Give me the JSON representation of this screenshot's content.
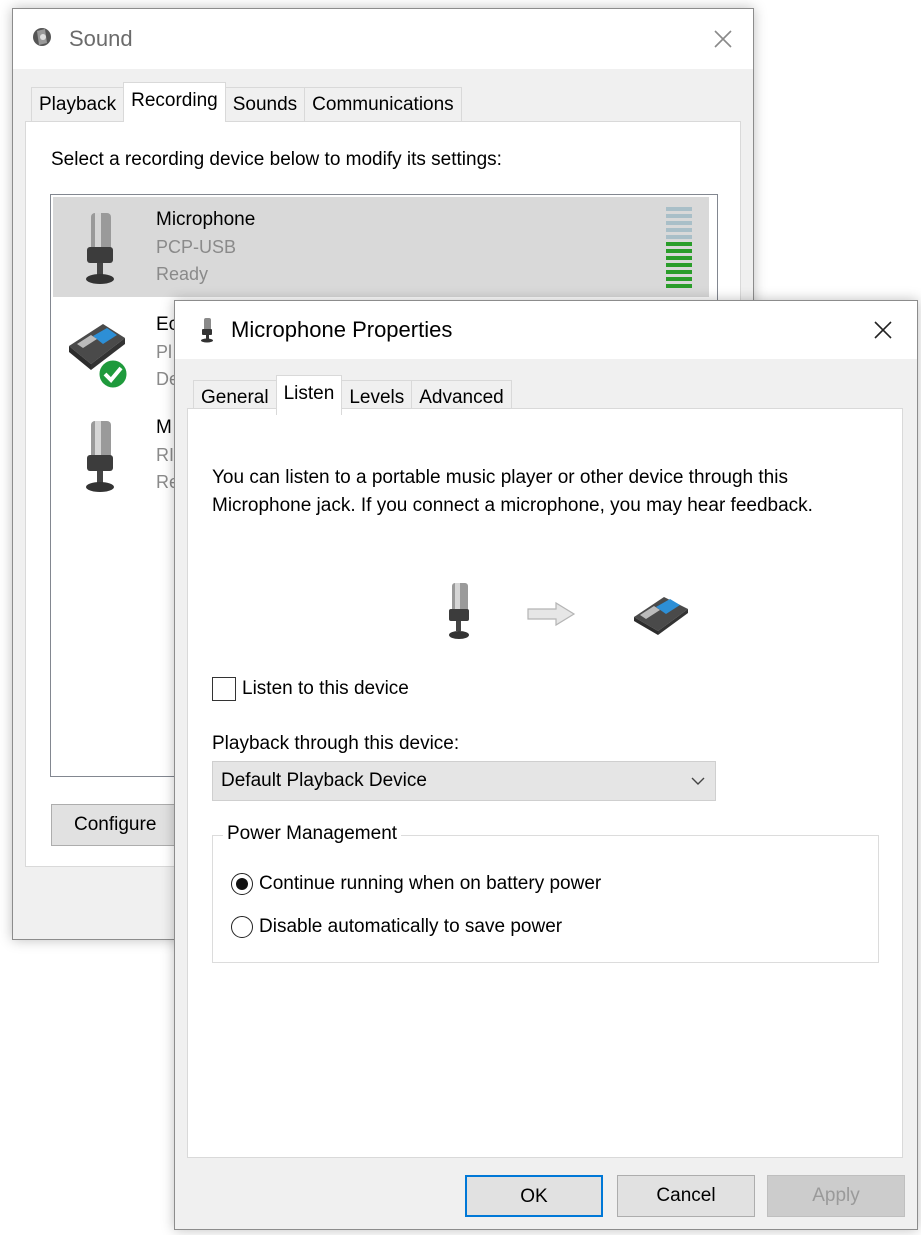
{
  "sound_window": {
    "title": "Sound",
    "tabs": [
      "Playback",
      "Recording",
      "Sounds",
      "Communications"
    ],
    "active_tab": "Recording",
    "instruction": "Select a recording device below to modify its settings:",
    "devices": [
      {
        "name": "Microphone",
        "sub": "PCP-USB",
        "status": "Ready",
        "icon": "microphone-icon",
        "selected": true
      },
      {
        "name": "Ec",
        "sub": "Pl",
        "status": "De",
        "icon": "speakerphone-icon",
        "default_badge": "checkmark-icon"
      },
      {
        "name": "M",
        "sub": "RI",
        "status": "Re",
        "icon": "microphone-icon"
      }
    ],
    "configure_label": "Configure",
    "meter_colors": {
      "active": "#2a9d2a",
      "inactive": "#a9bfc8"
    }
  },
  "props_window": {
    "title": "Microphone Properties",
    "tabs": [
      "General",
      "Listen",
      "Levels",
      "Advanced"
    ],
    "active_tab": "Listen",
    "description": "You can listen to a portable music player or other device through this Microphone jack.  If you connect a microphone, you may hear feedback.",
    "listen_checkbox_label": "Listen to this device",
    "listen_checked": false,
    "playback_label": "Playback through this device:",
    "playback_value": "Default Playback Device",
    "power_group_title": "Power Management",
    "power_options": [
      "Continue running when on battery power",
      "Disable automatically to save power"
    ],
    "power_selected": "Continue running when on battery power",
    "ok_label": "OK",
    "cancel_label": "Cancel",
    "apply_label": "Apply",
    "accent_color": "#0078d7"
  }
}
